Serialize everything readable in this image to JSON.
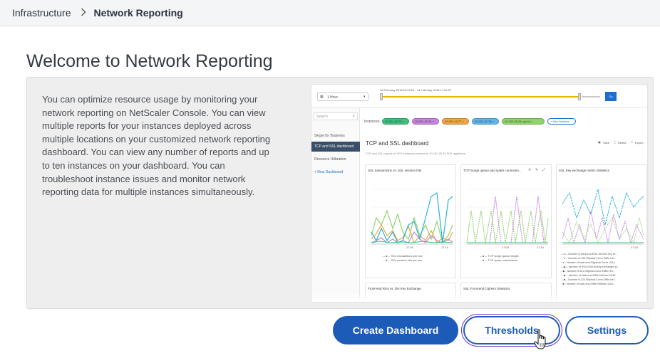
{
  "breadcrumb": {
    "root": "Infrastructure",
    "separator": ">",
    "current": "Network Reporting"
  },
  "page": {
    "title": "Welcome to Network Reporting",
    "description": "You can optimize resource usage by monitoring your network reporting on NetScaler Console. You can view multiple reports for your instances deployed across multiple locations on your customized network reporting dashboard. You can view any number of reports and up to ten instances on your dashboard. You can troubleshoot instance issues and monitor network reporting data for multiple instances simultaneously."
  },
  "preview": {
    "time_select": "1 Hour",
    "time_range": "14 February 2018 16:22:20 - 14 February 2018 17:22:22",
    "go_label": "Go",
    "search_placeholder": "Search",
    "sidebar_items": [
      "Skype for Business",
      "TCP and SSL dashboard",
      "Resource Utilization"
    ],
    "new_dashboard": "+ New Dashboard",
    "instances_label": "Instances:",
    "instance_pills": [
      {
        "label": "10.221.42.75 ×",
        "color": "#3fbf7f"
      },
      {
        "label": "10.221.42.76 ×",
        "color": "#c884e0"
      },
      {
        "label": "10.221.42.77 ×",
        "color": "#f2a545"
      },
      {
        "label": "10.221.42.78 ×",
        "color": "#5fb6e8"
      },
      {
        "label": "10.102.26.24-vpx-N ×",
        "color": "#8fd46a"
      }
    ],
    "add_instance": "+ Add Instance",
    "dashboard_title": "TCP and SSL dashboard",
    "dashboard_subtitle": "TCP and SSL reports of VPX instances present in 10.102.26.24 SDX appliance",
    "actions": {
      "save": "Save",
      "delete": "Delete",
      "export": "Export"
    },
    "cards": [
      {
        "title": "SSL transactions vs. SSL session hits",
        "legend": [
          "SSL transactions per sec",
          "SSL session hits per sec"
        ],
        "x_labels": [
          "17:00",
          "17:10"
        ]
      },
      {
        "title": "TCP Surge queue and spare connectio...",
        "legend": [
          "TCP surge queue length",
          "TCP spare connections"
        ],
        "x_labels": [
          "17:00",
          "17:10"
        ]
      },
      {
        "title": "SSL Key exchange metric Statistics",
        "legend": [
          "Number of back-end RSA 1024-bit key ex...",
          "Number of 256 Elliptical Curve Diffie-Hel...",
          "Number of back-end Ellyptical Curve 1024...",
          "Number of RSA 2048-bit key exchanges pr...",
          "Number of 521 Elliptical Curve Diffie-Hel...",
          "Number of back-end Diffie-Hellman 2048...",
          "Number of 224 Elliptical Curve Diffie-Hel...",
          "Number of back-end Diffie-Hellman 1024..."
        ],
        "x_labels": [
          "17:20"
        ]
      },
      {
        "title": "Front-end RSA vs. DH Key Exchange"
      },
      {
        "title": "SSL Front-end Ciphers Statistics"
      }
    ]
  },
  "buttons": {
    "create_dashboard": "Create Dashboard",
    "thresholds": "Thresholds",
    "settings": "Settings"
  },
  "colors": {
    "primary": "#1c5bb8",
    "focus_ring": "#6d35c8",
    "panel_bg": "#eeeeee"
  }
}
